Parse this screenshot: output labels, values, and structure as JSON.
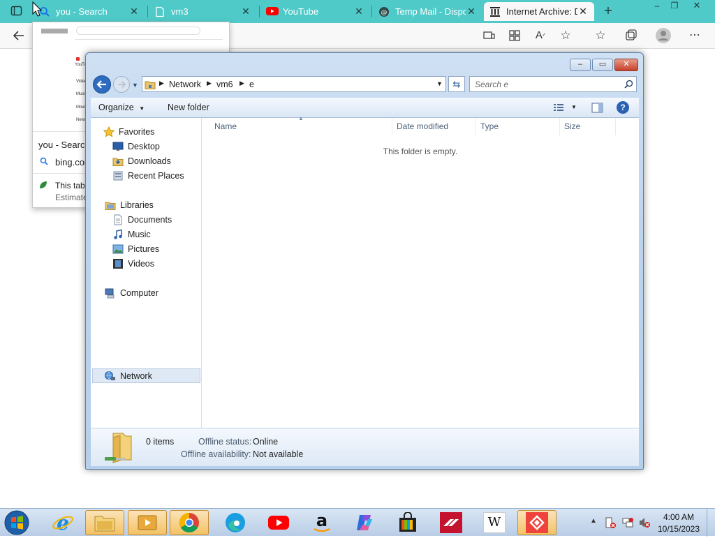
{
  "browser": {
    "tabs": [
      {
        "label": "you - Search",
        "icon": "search-icon",
        "color": "#1a73e8"
      },
      {
        "label": "vm3",
        "icon": "document-icon"
      },
      {
        "label": "YouTube",
        "icon": "youtube-icon",
        "color": "#ff0000"
      },
      {
        "label": "Temp Mail - Disposable",
        "icon": "tempmail-icon"
      },
      {
        "label": "Internet Archive: Digital",
        "icon": "archive-icon",
        "active": true
      }
    ],
    "new_tab": "+",
    "window_controls": {
      "minimize": "–",
      "restore": "❐",
      "close": "✕"
    },
    "toolbar_icons": [
      "back-icon",
      "app-available-icon",
      "apps-icon",
      "read-aloud-icon",
      "add-favorite-icon",
      "favorites-icon",
      "collections-icon",
      "profile-icon",
      "more-icon"
    ],
    "tab_preview": {
      "title": "you - Search",
      "url": "bing.com",
      "sleep_text": "This tab",
      "estimate_text": "Estimate",
      "thumbnail_lines": [
        "YouTube",
        "Video",
        "Music",
        "Movies",
        "News"
      ]
    }
  },
  "explorer": {
    "window_controls": {
      "minimize": "–",
      "maximize": "▭",
      "close": "✕"
    },
    "breadcrumb": [
      "Network",
      "vm6",
      "e"
    ],
    "search_placeholder": "Search e",
    "commands": {
      "organize": "Organize",
      "new_folder": "New folder"
    },
    "nav": {
      "favorites": {
        "label": "Favorites",
        "items": [
          "Desktop",
          "Downloads",
          "Recent Places"
        ]
      },
      "libraries": {
        "label": "Libraries",
        "items": [
          "Documents",
          "Music",
          "Pictures",
          "Videos"
        ]
      },
      "computer": "Computer",
      "network": "Network"
    },
    "columns": [
      "Name",
      "Date modified",
      "Type",
      "Size"
    ],
    "empty_text": "This folder is empty.",
    "details": {
      "count": "0 items",
      "offline_status_label": "Offline status:",
      "offline_status_value": "Online",
      "offline_avail_label": "Offline availability:",
      "offline_avail_value": "Not available"
    }
  },
  "taskbar": {
    "apps": [
      "Start",
      "Internet Explorer",
      "Windows Explorer",
      "Media Player",
      "Chrome",
      "Edge",
      "YouTube",
      "Amazon",
      "Copilot",
      "Store",
      "Bank of America",
      "Wikipedia",
      "AnyDesk"
    ],
    "clock": {
      "time": "4:00 AM",
      "date": "10/15/2023"
    },
    "colors": {
      "accent": "#4fcac8",
      "youtube": "#ff0000",
      "bank": "#c4122f",
      "anydesk": "#ef443b"
    }
  }
}
